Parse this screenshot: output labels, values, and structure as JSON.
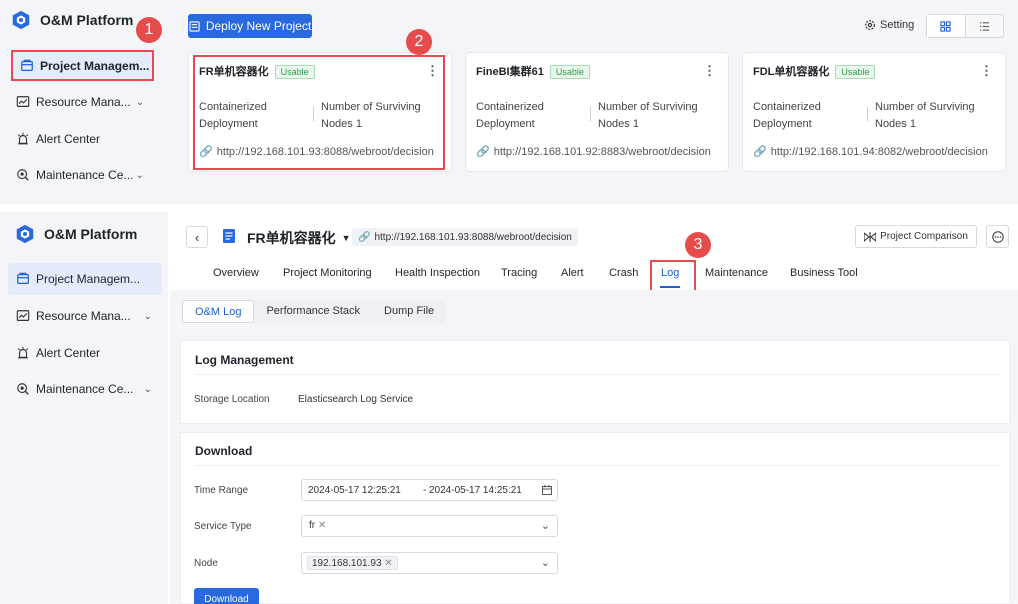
{
  "app": {
    "brand": "O&M Platform"
  },
  "sidebar": {
    "items": [
      {
        "label": "Project Managem...",
        "icon": "project-icon"
      },
      {
        "label": "Resource Mana...",
        "icon": "resource-chart-icon"
      },
      {
        "label": "Alert Center",
        "icon": "alarm-icon"
      },
      {
        "label": "Maintenance Ce...",
        "icon": "maintenance-icon"
      }
    ]
  },
  "toolbar": {
    "deploy_label": "Deploy New Project",
    "setting_label": "Setting"
  },
  "cards": [
    {
      "name": "FR单机容器化",
      "status": "Usable",
      "mode": "Containerized Deployment",
      "nodes": "Number of Surviving Nodes 1",
      "url": "http://192.168.101.93:8088/webroot/decision"
    },
    {
      "name": "FineBI集群61",
      "status": "Usable",
      "mode": "Containerized Deployment",
      "nodes": "Number of Surviving Nodes 1",
      "url": "http://192.168.101.92:8883/webroot/decision"
    },
    {
      "name": "FDL单机容器化",
      "status": "Usable",
      "mode": "Containerized Deployment",
      "nodes": "Number of Surviving Nodes 1",
      "url": "http://192.168.101.94:8082/webroot/decision"
    }
  ],
  "detail": {
    "project_name": "FR单机容器化",
    "url": "http://192.168.101.93:8088/webroot/decision",
    "compare_label": "Project Comparison",
    "tabs": [
      "Overview",
      "Project Monitoring",
      "Health Inspection",
      "Tracing",
      "Alert",
      "Crash",
      "Log",
      "Maintenance",
      "Business Tool"
    ],
    "subtabs": [
      "O&M Log",
      "Performance Stack",
      "Dump File"
    ]
  },
  "log_management": {
    "title": "Log Management",
    "storage_label": "Storage Location",
    "storage_value": "Elasticsearch Log Service"
  },
  "download": {
    "title": "Download",
    "time_label": "Time Range",
    "time_start": "2024-05-17 12:25:21",
    "time_sep": "-",
    "time_end": "2024-05-17 14:25:21",
    "service_label": "Service Type",
    "service_tag": "fr",
    "node_label": "Node",
    "node_tag": "192.168.101.93",
    "button_label": "Download"
  },
  "annotations": [
    "1",
    "2",
    "3"
  ],
  "colors": {
    "accent": "#2869e0",
    "highlight": "#e74c4c",
    "usable": "#2f9a48"
  }
}
